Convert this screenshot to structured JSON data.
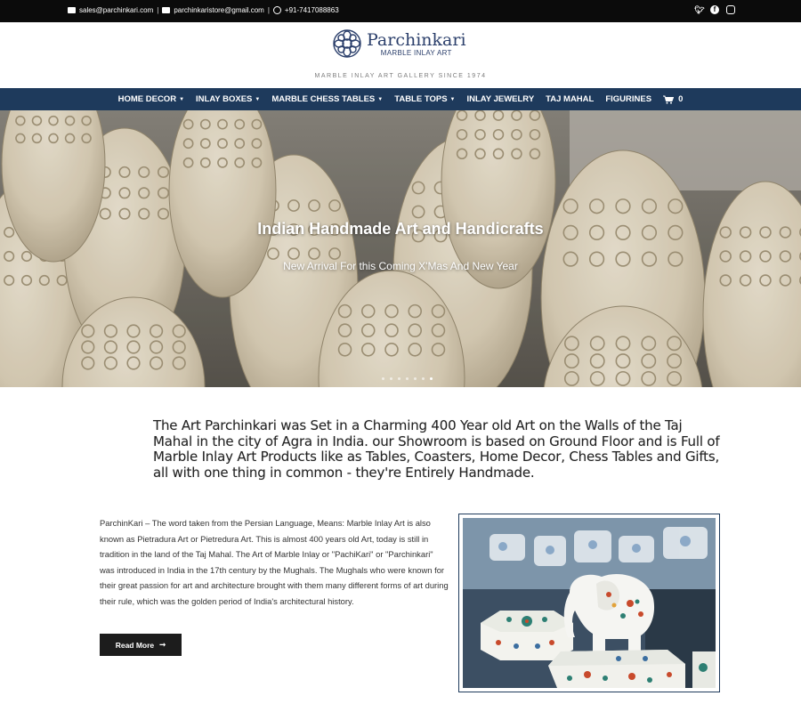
{
  "topbar": {
    "email_1": "sales@parchinkari.com",
    "email_2": "parchinkaristore@gmail.com",
    "phone": "+91-7417088863",
    "separator": "|",
    "social_icons": [
      "twitter-icon",
      "facebook-icon",
      "instagram-icon"
    ]
  },
  "logo": {
    "name": "Parchinkari",
    "sub": "MARBLE INLAY ART"
  },
  "tagline": "MARBLE INLAY ART GALLERY SINCE 1974",
  "nav": {
    "items": [
      {
        "label": "HOME DECOR",
        "dropdown": true
      },
      {
        "label": "INLAY BOXES",
        "dropdown": true
      },
      {
        "label": "MARBLE CHESS TABLES",
        "dropdown": true
      },
      {
        "label": "TABLE TOPS",
        "dropdown": true
      },
      {
        "label": "INLAY JEWELRY",
        "dropdown": false
      },
      {
        "label": "TAJ MAHAL",
        "dropdown": false
      },
      {
        "label": "FIGURINES",
        "dropdown": false
      }
    ],
    "cart_count": "0"
  },
  "hero": {
    "title": "Indian Handmade Art and Handicrafts",
    "subtitle": "New Arrival For this Coming X'Mas And New Year",
    "slide_count": 7,
    "active_slide": 6
  },
  "intro": "The Art Parchinkari was Set in a Charming 400 Year old Art on the Walls of the Taj Mahal in the city of Agra in India. our Showroom is based on Ground Floor and is Full of Marble Inlay Art Products like as Tables, Coasters, Home Decor, Chess Tables and Gifts, all with one thing in common - they're Entirely Handmade.",
  "about": {
    "text": "ParchinKari – The word taken from the Persian Language, Means: Marble Inlay Art is also known as Pietradura Art or Pietredura Art. This is almost 400 years old Art, today is still in tradition in the land of the Taj Mahal. The Art of Marble Inlay or \"PachiKari\" or \"Parchinkari\" was introduced in India in the 17th century by the Mughals. The Mughals who were known for their great passion for art and architecture brought with them many different forms of art during their rule, which was the golden period of India's architectural history.",
    "read_more": "Read More"
  },
  "colors": {
    "topbar_bg": "#0b0b0b",
    "nav_bg": "#1e3a5c",
    "brand": "#2b3f6b",
    "button_bg": "#1c1c1c"
  }
}
